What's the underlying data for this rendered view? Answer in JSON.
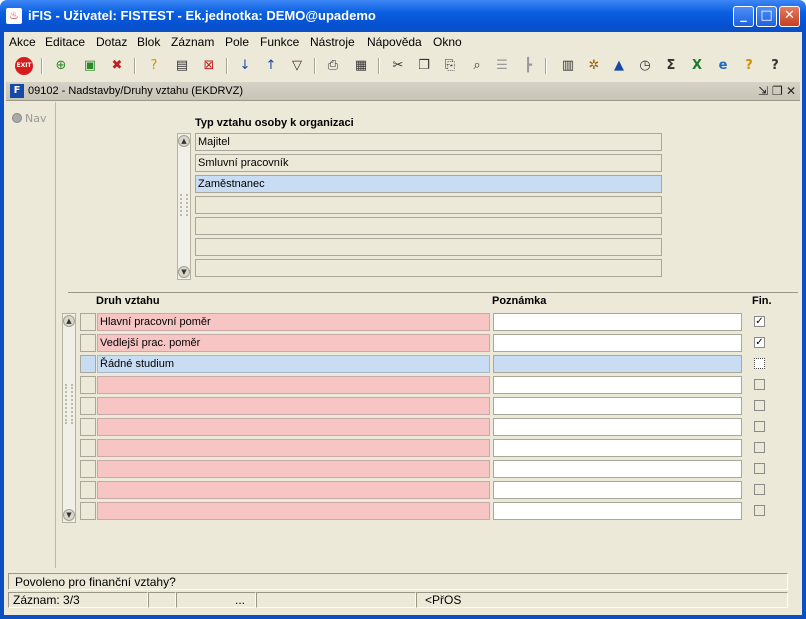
{
  "window": {
    "title": "iFIS - Uživatel: FISTEST - Ek.jednotka: DEMO@upademo",
    "app_icon": "iFIS-app-icon",
    "controls": [
      "_",
      "□",
      "✕"
    ]
  },
  "menu": [
    {
      "label": "Akce"
    },
    {
      "label": "Editace"
    },
    {
      "label": "Dotaz"
    },
    {
      "label": "Blok"
    },
    {
      "label": "Záznam"
    },
    {
      "label": "Pole"
    },
    {
      "label": "Funkce"
    },
    {
      "label": "Nástroje"
    },
    {
      "label": "Nápověda"
    },
    {
      "label": "Okno"
    }
  ],
  "toolbar": {
    "icons": [
      "exit-icon",
      "add-record-icon",
      "save-record-icon",
      "delete-record-icon",
      "query-icon",
      "execute-query-icon",
      "cancel-query-icon",
      "sort-asc-icon",
      "sort-desc-icon",
      "filter-icon",
      "print-icon",
      "print-preview-icon",
      "cut-icon",
      "copy-icon",
      "paste-icon",
      "find-icon",
      "list-icon",
      "tree-icon",
      "calculator-icon",
      "settings-icon",
      "chart-icon",
      "clock-icon",
      "sum-icon",
      "excel-icon",
      "ie-icon",
      "help-question-icon",
      "help-icon"
    ],
    "exit_label": "EXIT"
  },
  "form": {
    "title": "09102 - Nadstavby/Druhy vztahu (EKDRVZ)",
    "nav_label": "Nav",
    "block1": {
      "header": "Typ vztahu osoby k organizaci",
      "rows": [
        "Majitel",
        "Smluvní pracovník",
        "Zaměstnanec",
        "",
        "",
        "",
        ""
      ],
      "current_index": 2
    },
    "block2": {
      "headers": {
        "druh": "Druh vztahu",
        "poznamka": "Poznámka",
        "fin": "Fin."
      },
      "rows": [
        {
          "druh": "Hlavní pracovní poměr",
          "poznamka": "",
          "fin": true
        },
        {
          "druh": "Vedlejší prac. poměr",
          "poznamka": "",
          "fin": true
        },
        {
          "druh": "Řádné studium",
          "poznamka": "",
          "fin": false
        },
        {
          "druh": "",
          "poznamka": "",
          "fin": false
        },
        {
          "druh": "",
          "poznamka": "",
          "fin": false
        },
        {
          "druh": "",
          "poznamka": "",
          "fin": false
        },
        {
          "druh": "",
          "poznamka": "",
          "fin": false
        },
        {
          "druh": "",
          "poznamka": "",
          "fin": false
        },
        {
          "druh": "",
          "poznamka": "",
          "fin": false
        },
        {
          "druh": "",
          "poznamka": "",
          "fin": false
        }
      ],
      "current_index": 2
    }
  },
  "status": {
    "hint": "Povoleno pro finanční vztahy?",
    "record": "Záznam: 3/3",
    "ellipsis": "...",
    "mode": "<PřOS"
  }
}
